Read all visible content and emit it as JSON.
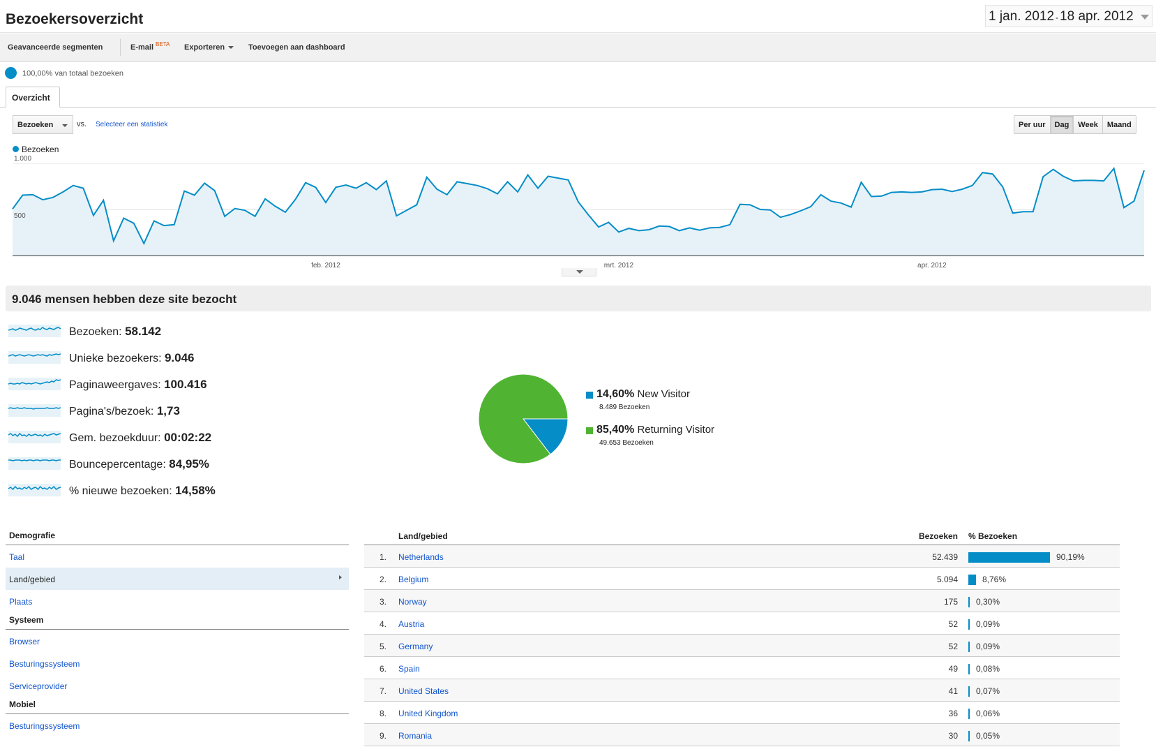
{
  "header": {
    "title": "Bezoekersoverzicht",
    "date_start": "1 jan. 2012",
    "date_sep": "-",
    "date_end": "18 apr. 2012"
  },
  "toolbar": {
    "segments": "Geavanceerde segmenten",
    "email": "E-mail",
    "beta": "BETA",
    "export": "Exporteren",
    "add_dashboard": "Toevoegen aan dashboard"
  },
  "segment": {
    "label": "100,00% van totaal bezoeken"
  },
  "tabs": {
    "overview": "Overzicht"
  },
  "chart_controls": {
    "metric": "Bezoeken",
    "vs": "vs.",
    "select_metric": "Selecteer een statistiek",
    "granularity": [
      "Per uur",
      "Dag",
      "Week",
      "Maand"
    ],
    "active_granularity": "Dag"
  },
  "chart_data": [
    {
      "type": "area",
      "series": [
        {
          "name": "Bezoeken",
          "values": [
            505,
            655,
            660,
            605,
            630,
            690,
            760,
            730,
            435,
            600,
            160,
            405,
            350,
            130,
            375,
            325,
            335,
            700,
            655,
            785,
            705,
            425,
            510,
            490,
            425,
            615,
            535,
            470,
            610,
            790,
            740,
            575,
            740,
            765,
            730,
            790,
            715,
            810,
            430,
            490,
            550,
            850,
            720,
            660,
            800,
            780,
            760,
            725,
            670,
            800,
            690,
            875,
            730,
            860,
            840,
            820,
            580,
            440,
            310,
            360,
            255,
            295,
            270,
            280,
            320,
            315,
            270,
            300,
            275,
            300,
            305,
            335,
            555,
            550,
            500,
            495,
            415,
            445,
            485,
            530,
            660,
            590,
            570,
            525,
            795,
            640,
            645,
            685,
            690,
            685,
            690,
            715,
            720,
            695,
            720,
            760,
            900,
            885,
            745,
            460,
            475,
            475,
            855,
            935,
            860,
            810,
            815,
            815,
            810,
            945,
            520,
            590,
            925
          ]
        }
      ],
      "xticks": [
        "feb. 2012",
        "mrt. 2012",
        "apr. 2012"
      ],
      "yticks": [
        "1.000",
        "500"
      ],
      "ylim": [
        0,
        1000
      ],
      "grid": true
    },
    {
      "type": "pie",
      "slices": [
        {
          "label": "New Visitor",
          "pct": "14,60%",
          "value": 14.6,
          "sub": "8.489 Bezoeken",
          "color": "#058dc7"
        },
        {
          "label": "Returning Visitor",
          "pct": "85,40%",
          "value": 85.4,
          "sub": "49.653 Bezoeken",
          "color": "#50b432"
        }
      ]
    }
  ],
  "summary": {
    "title": "9.046 mensen hebben deze site bezocht"
  },
  "metrics": [
    {
      "label": "Bezoeken:",
      "value": "58.142"
    },
    {
      "label": "Unieke bezoekers:",
      "value": "9.046"
    },
    {
      "label": "Paginaweergaves:",
      "value": "100.416"
    },
    {
      "label": "Pagina's/bezoek:",
      "value": "1,73"
    },
    {
      "label": "Gem. bezoekduur:",
      "value": "00:02:22"
    },
    {
      "label": "Bouncepercentage:",
      "value": "84,95%"
    },
    {
      "label": "% nieuwe bezoeken:",
      "value": "14,58%"
    }
  ],
  "nav": {
    "demografie": "Demografie",
    "taal": "Taal",
    "land": "Land/gebied",
    "plaats": "Plaats",
    "systeem": "Systeem",
    "browser": "Browser",
    "os": "Besturingssysteem",
    "provider": "Serviceprovider",
    "mobiel": "Mobiel",
    "mobile_os": "Besturingssysteem"
  },
  "table": {
    "col_country": "Land/gebied",
    "col_visits": "Bezoeken",
    "col_pct": "% Bezoeken",
    "rows": [
      {
        "rank": "1.",
        "country": "Netherlands",
        "visits": "52.439",
        "pct": "90,19%",
        "fraction": 0.9019
      },
      {
        "rank": "2.",
        "country": "Belgium",
        "visits": "5.094",
        "pct": "8,76%",
        "fraction": 0.0876
      },
      {
        "rank": "3.",
        "country": "Norway",
        "visits": "175",
        "pct": "0,30%",
        "fraction": 0.003
      },
      {
        "rank": "4.",
        "country": "Austria",
        "visits": "52",
        "pct": "0,09%",
        "fraction": 0.0009
      },
      {
        "rank": "5.",
        "country": "Germany",
        "visits": "52",
        "pct": "0,09%",
        "fraction": 0.0009
      },
      {
        "rank": "6.",
        "country": "Spain",
        "visits": "49",
        "pct": "0,08%",
        "fraction": 0.0008
      },
      {
        "rank": "7.",
        "country": "United States",
        "visits": "41",
        "pct": "0,07%",
        "fraction": 0.0007
      },
      {
        "rank": "8.",
        "country": "United Kingdom",
        "visits": "36",
        "pct": "0,06%",
        "fraction": 0.0006
      },
      {
        "rank": "9.",
        "country": "Romania",
        "visits": "30",
        "pct": "0,05%",
        "fraction": 0.0005
      }
    ]
  },
  "colors": {
    "accent": "#058dc7",
    "green": "#50b432",
    "link": "#1155cc"
  }
}
